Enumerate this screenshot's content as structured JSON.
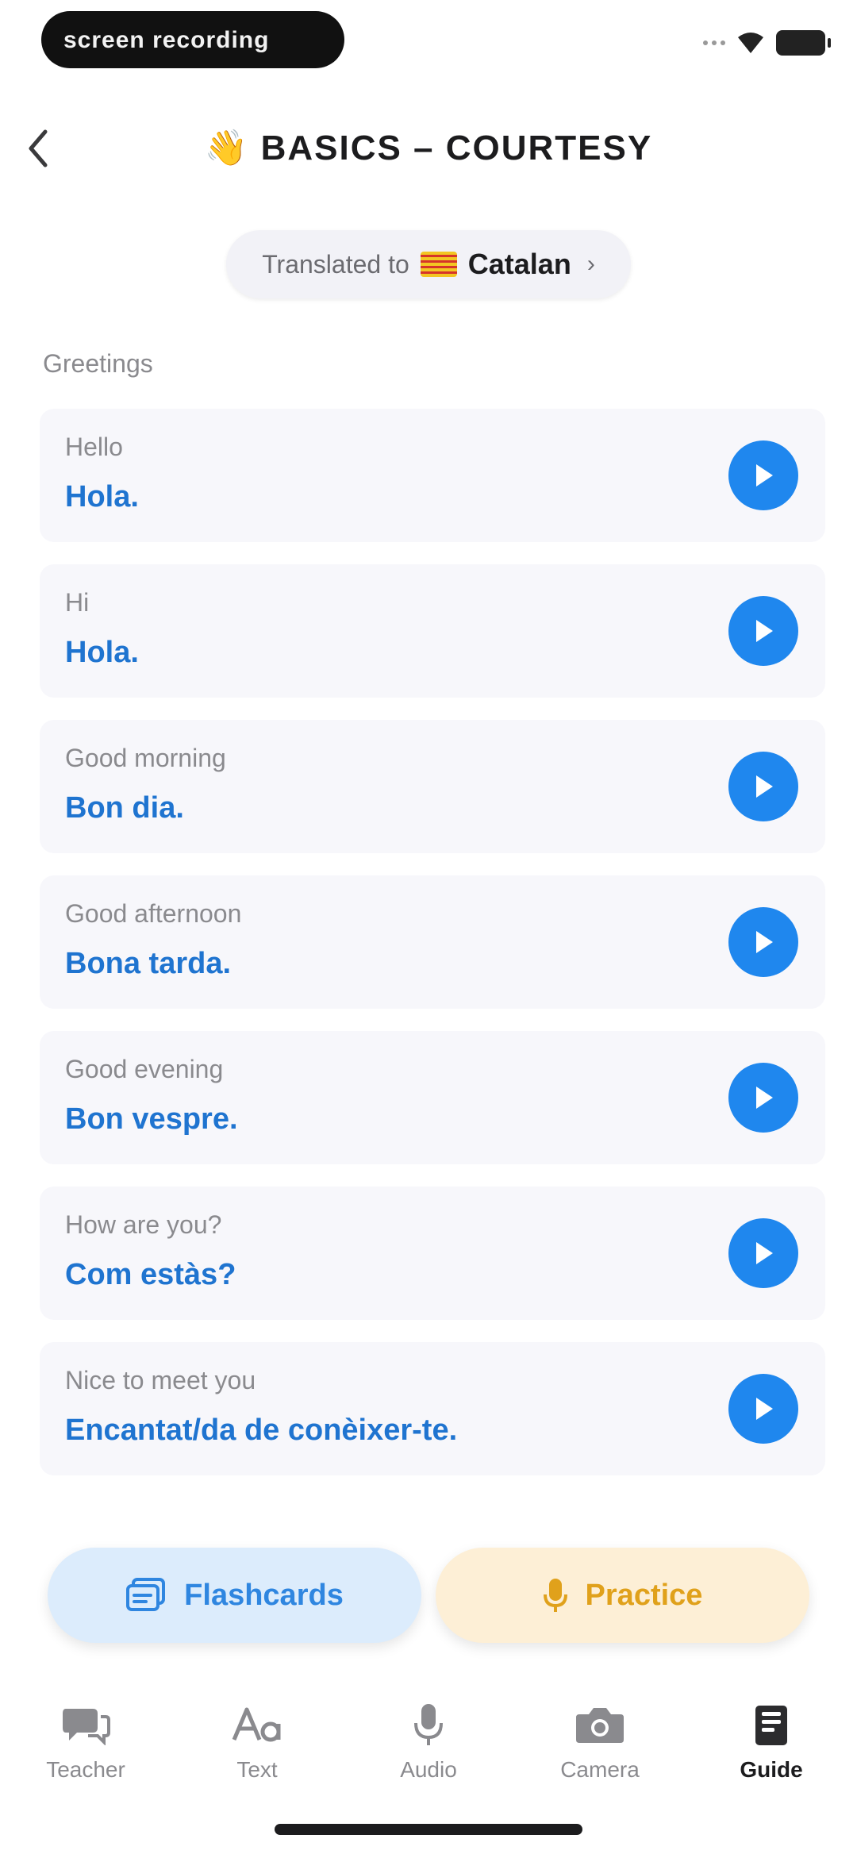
{
  "status_bar": {
    "pill_text": "screen recording"
  },
  "header": {
    "title": "BASICS – COURTESY",
    "title_emoji": "👋"
  },
  "language_selector": {
    "prefix": "Translated to",
    "language": "Catalan",
    "chevron": "›"
  },
  "section": {
    "title": "Greetings"
  },
  "phrases": [
    {
      "english": "Hello",
      "translation": "Hola."
    },
    {
      "english": "Hi",
      "translation": "Hola."
    },
    {
      "english": "Good morning",
      "translation": "Bon dia."
    },
    {
      "english": "Good afternoon",
      "translation": "Bona tarda."
    },
    {
      "english": "Good evening",
      "translation": "Bon vespre."
    },
    {
      "english": "How are you?",
      "translation": "Com estàs?"
    },
    {
      "english": "Nice to meet you",
      "translation": "Encantat/da de conèixer-te."
    }
  ],
  "actions": {
    "flashcards": "Flashcards",
    "practice": "Practice"
  },
  "tabs": [
    {
      "label": "Teacher",
      "icon": "chat-bubbles-icon"
    },
    {
      "label": "Text",
      "icon": "text-aa-icon"
    },
    {
      "label": "Audio",
      "icon": "microphone-icon"
    },
    {
      "label": "Camera",
      "icon": "camera-icon"
    },
    {
      "label": "Guide",
      "icon": "guide-book-icon",
      "active": true
    }
  ],
  "colors": {
    "accent_blue": "#1f87ee",
    "translation_text": "#1f74d0",
    "practice_orange": "#e0a11b",
    "flashcards_bg": "#dcecfc",
    "practice_bg": "#fdefd6"
  }
}
